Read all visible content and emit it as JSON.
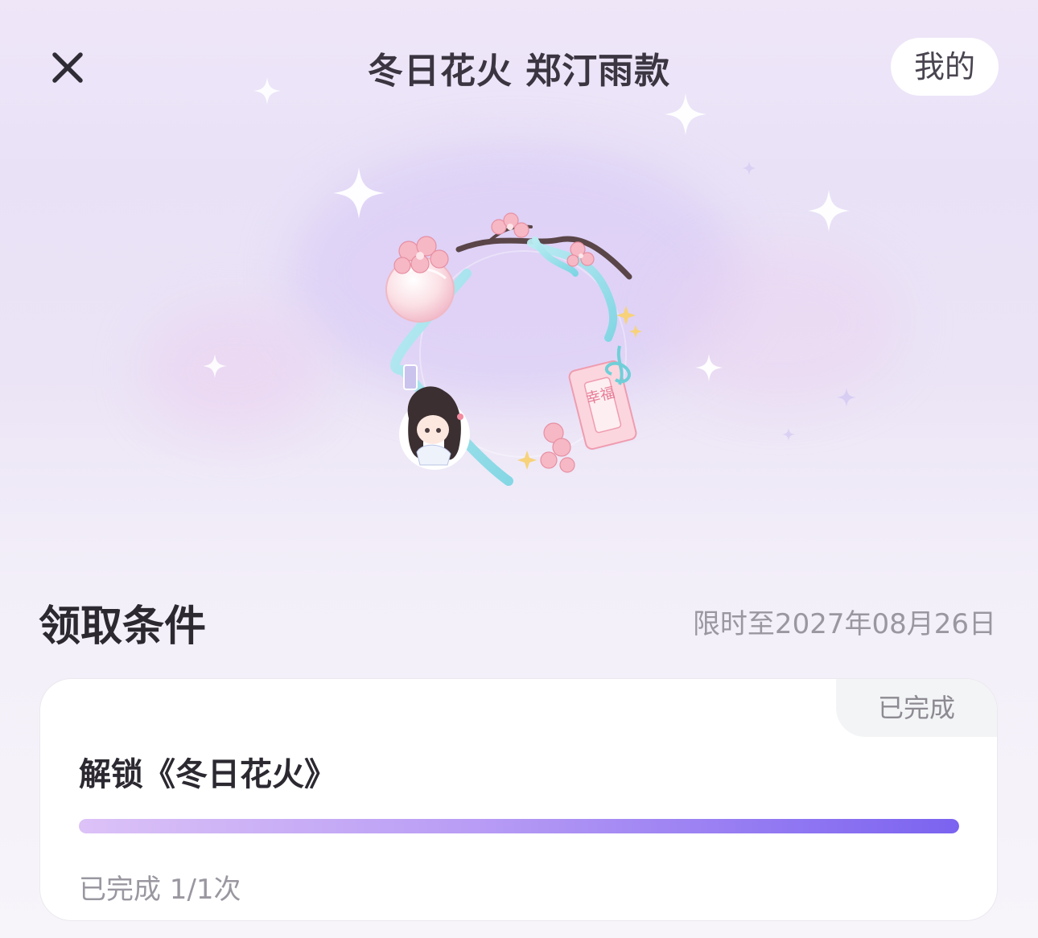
{
  "header": {
    "title": "冬日花火 郑汀雨款",
    "mine_label": "我的"
  },
  "artwork": {
    "charm_text": "幸福"
  },
  "conditions": {
    "section_title": "领取条件",
    "deadline": "限时至2027年08月26日"
  },
  "task": {
    "status": "已完成",
    "title": "解锁《冬日花火》",
    "progress_fraction": 1,
    "progress_label": "已完成 1/1次"
  },
  "colors": {
    "progress_start": "#dcc2f7",
    "progress_end": "#7b63f0",
    "background": "#ece5f7"
  }
}
